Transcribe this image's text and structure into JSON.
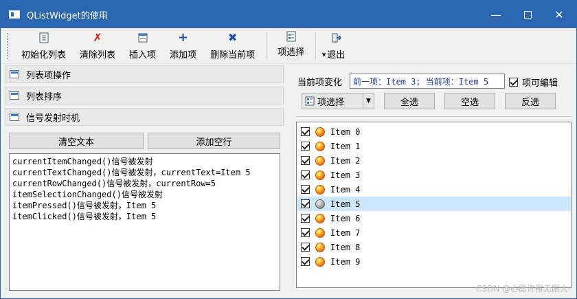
{
  "window": {
    "title": "QListWidget的使用"
  },
  "toolbar": {
    "items": [
      {
        "label": "初始化列表",
        "icon": "list-init-icon"
      },
      {
        "label": "清除列表",
        "icon": "red-x-icon"
      },
      {
        "label": "插入项",
        "icon": "insert-icon"
      },
      {
        "label": "添加项",
        "icon": "plus-icon"
      },
      {
        "label": "删除当前项",
        "icon": "delete-x-icon"
      },
      {
        "label": "项选择",
        "icon": "select-icon"
      },
      {
        "label": "退出",
        "icon": "exit-icon"
      }
    ]
  },
  "left": {
    "sections": [
      "列表项操作",
      "列表排序",
      "信号发射时机"
    ],
    "clear_text_label": "清空文本",
    "add_blank_label": "添加空行",
    "log": "currentItemChanged()信号被发射\ncurrentTextChanged()信号被发射，currentText=Item 5\ncurrentRowChanged()信号被发射，currentRow=5\nitemSelectionChanged()信号被发射\nitemPressed()信号被发射，Item 5\nitemClicked()信号被发射，Item 5"
  },
  "right": {
    "current_change_label": "当前项变化",
    "current_change_value": "前一项：Item 3; 当前项：Item 5",
    "editable_label": "项可编辑",
    "combo_label": "项选择",
    "select_all_label": "全选",
    "select_none_label": "空选",
    "invert_label": "反选",
    "items": [
      {
        "text": "Item 0",
        "checked": true
      },
      {
        "text": "Item 1",
        "checked": true
      },
      {
        "text": "Item 2",
        "checked": true
      },
      {
        "text": "Item 3",
        "checked": true
      },
      {
        "text": "Item 4",
        "checked": true
      },
      {
        "text": "Item 5",
        "checked": true,
        "selected": true
      },
      {
        "text": "Item 6",
        "checked": true
      },
      {
        "text": "Item 7",
        "checked": true
      },
      {
        "text": "Item 8",
        "checked": true
      },
      {
        "text": "Item 9",
        "checked": true
      }
    ]
  },
  "watermark": "CSDN @心愿许得无限大",
  "colors": {
    "titlebar": "#2a66b2",
    "selected_row": "#cce8ff"
  }
}
